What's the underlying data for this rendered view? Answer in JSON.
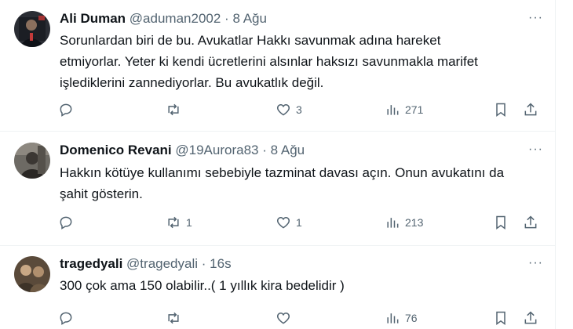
{
  "tweets": [
    {
      "name": "Ali Duman",
      "handle": "@aduman2002",
      "sep": "·",
      "time": "8 Ağu",
      "more": "···",
      "lines": [
        "Sorunlardan biri de bu. Avukatlar Hakkı savunmak adına  hareket",
        "etmiyorlar. Yeter ki kendi ücretlerini alsınlar haksızı savunmakla marifet",
        "işlediklerini zannediyorlar. Bu avukatlık değil."
      ],
      "replies": "",
      "retweets": "",
      "likes": "3",
      "views": "271"
    },
    {
      "name": "Domenico Revani",
      "handle": "@19Aurora83",
      "sep": "·",
      "time": "8 Ağu",
      "more": "···",
      "lines": [
        "Hakkın kötüye kullanımı sebebiyle tazminat davası açın. Onun avukatını da",
        "şahit gösterin."
      ],
      "replies": "",
      "retweets": "1",
      "likes": "1",
      "views": "213"
    },
    {
      "name": "tragedyali",
      "handle": "@tragedyali",
      "sep": "·",
      "time": "16s",
      "more": "···",
      "lines": [
        "300 çok ama 150 olabilir..( 1 yıllık kira bedelidir )"
      ],
      "replies": "",
      "retweets": "",
      "likes": "",
      "views": "76"
    }
  ],
  "icons": {
    "reply": "reply-icon",
    "retweet": "retweet-icon",
    "like": "heart-icon",
    "views": "views-chart-icon",
    "bookmark": "bookmark-icon",
    "share": "share-icon",
    "more": "more-dots-icon"
  },
  "colors": {
    "text": "#0f1419",
    "secondary": "#536471",
    "border": "#eff3f4"
  }
}
